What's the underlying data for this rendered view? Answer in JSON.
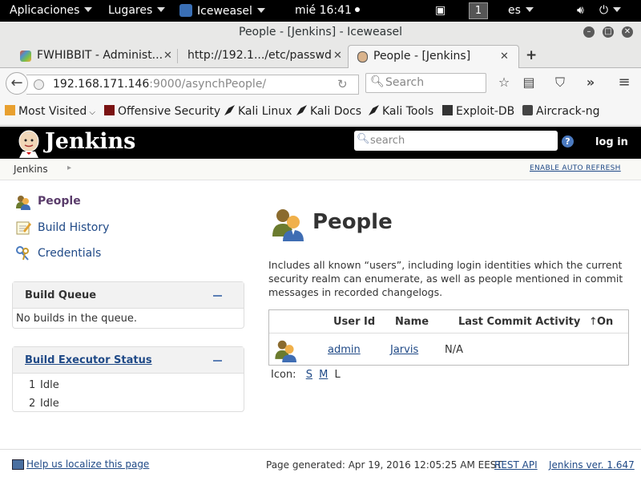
{
  "topbar": {
    "applications": "Aplicaciones",
    "places": "Lugares",
    "app_name": "Iceweasel",
    "clock": "mié 16:41",
    "workspace": "1",
    "keyboard": "es"
  },
  "window": {
    "title": "People - [Jenkins] - Iceweasel"
  },
  "tabs": [
    {
      "label": "FWHIBBIT - Administ...",
      "active": false
    },
    {
      "label": "http://192.1.../etc/passwd",
      "active": false
    },
    {
      "label": "People - [Jenkins]",
      "active": true
    }
  ],
  "urlbar": {
    "host": "192.168.171.146",
    "path": ":9000/asynchPeople/"
  },
  "searchbar": {
    "placeholder": "Search"
  },
  "bookmarks": [
    "Most Visited",
    "Offensive Security",
    "Kali Linux",
    "Kali Docs",
    "Kali Tools",
    "Exploit-DB",
    "Aircrack-ng"
  ],
  "jenkins": {
    "title": "Jenkins",
    "search_placeholder": "search",
    "login": "log in",
    "breadcrumb_root": "Jenkins",
    "auto_refresh": "ENABLE AUTO REFRESH"
  },
  "sidebar": {
    "tasks": [
      "People",
      "Build History",
      "Credentials"
    ],
    "build_queue": {
      "title": "Build Queue",
      "empty": "No builds in the queue."
    },
    "executors": {
      "title": "Build Executor Status",
      "rows": [
        {
          "num": "1",
          "status": "Idle"
        },
        {
          "num": "2",
          "status": "Idle"
        }
      ]
    }
  },
  "main": {
    "title": "People",
    "description": "Includes all known “users”, including login identities which the current security realm can enumerate, as well as people mentioned in commit messages in recorded changelogs.",
    "table": {
      "headers": [
        "User Id",
        "Name",
        "Last Commit Activity",
        "On"
      ],
      "sort_indicator": "↑",
      "rows": [
        {
          "user_id": "admin",
          "name": "Jarvis",
          "last_commit": "N/A",
          "on": ""
        }
      ]
    },
    "icon_size": {
      "label": "Icon:",
      "options": [
        "S",
        "M",
        "L"
      ]
    }
  },
  "footer": {
    "localize": "Help us localize this page",
    "generated": "Page generated: Apr 19, 2016 12:05:25 AM EEST",
    "rest_api": "REST API",
    "version": "Jenkins ver. 1.647"
  },
  "colors": {
    "link": "#204a87",
    "header_bg": "#000000",
    "gnome_bar": "#000000"
  }
}
